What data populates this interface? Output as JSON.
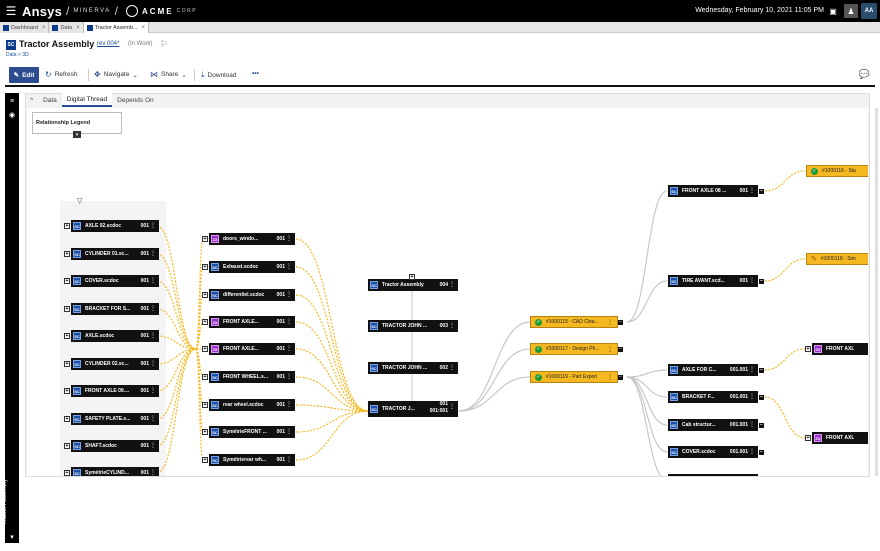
{
  "topbar": {
    "brand": "Ansys",
    "product": "MINERVA",
    "company": "ACME",
    "company_sub": "CORP",
    "datetime": "Wednesday, February 10, 2021 11:05 PM",
    "avatar": "AA"
  },
  "browser_tabs": [
    {
      "label": "Dashboard",
      "active": false
    },
    {
      "label": "Data",
      "active": false
    },
    {
      "label": "Tractor Assemb...",
      "active": true
    }
  ],
  "header": {
    "icon_text": "SC",
    "title": "Tractor Assembly",
    "revision": "rev 004*",
    "state": "(In Work)",
    "breadcrumb": "Data > 3D"
  },
  "toolbar": {
    "edit": "Edit",
    "refresh": "Refresh",
    "navigate": "Navigate",
    "share": "Share",
    "download": "Download",
    "more": "•••"
  },
  "panel_tabs": [
    "Data",
    "Digital Thread",
    "Depends On"
  ],
  "active_panel_tab": "Digital Thread",
  "legend": {
    "title": "Relationship Legend"
  },
  "rail": {
    "label": "Tractor Assembly"
  },
  "graph": {
    "left_column": [
      {
        "label": "AXLE 02.scdoc",
        "rev": "001"
      },
      {
        "label": "CYLINDER 01.sc...",
        "rev": "001"
      },
      {
        "label": "COVER.scdoc",
        "rev": "001"
      },
      {
        "label": "BRACKET FOR S...",
        "rev": "001"
      },
      {
        "label": "AXLE.scdoc",
        "rev": "001"
      },
      {
        "label": "CYLINDER 02.sc...",
        "rev": "001"
      },
      {
        "label": "FRONT AXLE 09....",
        "rev": "001"
      },
      {
        "label": "SAFETY PLATE.s...",
        "rev": "001"
      },
      {
        "label": "SHAFT.scdoc",
        "rev": "001"
      },
      {
        "label": "SymétrieCYLIND...",
        "rev": "001"
      }
    ],
    "second_column": [
      {
        "label": "doors_windo...",
        "rev": "001",
        "purple": true
      },
      {
        "label": "Exhaust.scdoc",
        "rev": "001",
        "purple": false
      },
      {
        "label": "differentiel.scdoc",
        "rev": "001",
        "purple": false
      },
      {
        "label": "FRONT AXLE...",
        "rev": "001",
        "purple": true
      },
      {
        "label": "FRONT AXLE...",
        "rev": "001",
        "purple": true
      },
      {
        "label": "FRONT WHEEL.s...",
        "rev": "001",
        "purple": false
      },
      {
        "label": "rear wheel.scdoc",
        "rev": "001",
        "purple": false
      },
      {
        "label": "SymétrieFRONT ...",
        "rev": "001",
        "purple": false
      },
      {
        "label": "Symétrierear wh...",
        "rev": "001",
        "purple": false
      }
    ],
    "center_column": [
      {
        "label": "Tractor Assembly",
        "rev": "004"
      },
      {
        "label": "TRACTOR JOHN ...",
        "rev": "003"
      },
      {
        "label": "TRACTOR JOHN ...",
        "rev": "002"
      },
      {
        "label": "TRACTOR J...",
        "rev": "001",
        "rev2": "001:001"
      }
    ],
    "cad_nodes": [
      {
        "label": "#1000115 - CAD Clea...",
        "status": "ok"
      },
      {
        "label": "#1000117 - Design Ph...",
        "status": "ok"
      },
      {
        "label": "#1000119 - Part Export",
        "status": "ok"
      }
    ],
    "upper_right": [
      {
        "label": "FRONT AXLE 08 ...",
        "rev": "001"
      },
      {
        "label": "TIRE AVANT.scd...",
        "rev": "001"
      }
    ],
    "lower_right": [
      {
        "label": "AXLE FOR C...",
        "rev": "001.001"
      },
      {
        "label": "BRACKET F...",
        "rev": "001.001"
      },
      {
        "label": "Cab structur...",
        "rev": "001.001"
      },
      {
        "label": "COVER.scdoc",
        "rev": "001.001"
      }
    ],
    "far_right_cad": [
      {
        "label": "#1000116 - Sta",
        "status": "ok"
      },
      {
        "label": "#1000118 - Sim",
        "status": "pending"
      }
    ],
    "far_right_nodes": [
      {
        "label": "FRONT AXL",
        "purple": true
      },
      {
        "label": "FRONT AXL",
        "purple": true
      }
    ]
  },
  "colors": {
    "node_bg": "#111111",
    "cad_bg": "#f5b820",
    "edge_dashed": "#f5b820",
    "edge_solid": "#c8c8c8",
    "accent": "#2b4d8f"
  }
}
